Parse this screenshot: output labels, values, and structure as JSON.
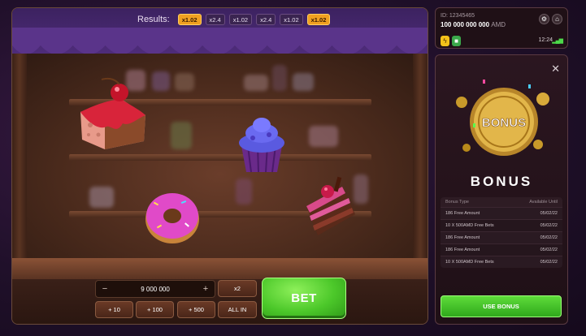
{
  "results": {
    "label": "Results:",
    "multipliers": [
      {
        "value": "x1.02",
        "highlighted": true
      },
      {
        "value": "x2.4",
        "highlighted": false
      },
      {
        "value": "x1.02",
        "highlighted": false
      },
      {
        "value": "x2.4",
        "highlighted": false
      },
      {
        "value": "x1.02",
        "highlighted": false
      },
      {
        "value": "x1.02",
        "highlighted": true
      }
    ]
  },
  "bet_controls": {
    "minus": "−",
    "plus": "+",
    "amount": "9 000 000",
    "double_label": "x2",
    "quick_adds": [
      "+ 10",
      "+ 100",
      "+ 500"
    ],
    "all_in_label": "ALL IN",
    "bet_label": "BET"
  },
  "account": {
    "id": "ID: 12345465",
    "balance": "100 000 000 000",
    "currency": "AMD",
    "time": "12:24",
    "settings_icon": "gear-icon",
    "home_icon": "home-icon"
  },
  "bonus": {
    "coin_text": "BONUS",
    "title": "BONUS",
    "columns": [
      "Bonus Type",
      "Available Until"
    ],
    "rows": [
      {
        "type": "186 Free Amount",
        "until": "05/02/22"
      },
      {
        "type": "10 X 500AMD Free Bets",
        "until": "05/02/22"
      },
      {
        "type": "186 Free Amount",
        "until": "05/02/22"
      },
      {
        "type": "186 Free Amount",
        "until": "05/02/22"
      },
      {
        "type": "10 X 500AMD Free Bets",
        "until": "05/02/22"
      }
    ],
    "use_label": "USE BONUS",
    "close_icon": "close-icon"
  },
  "colors": {
    "accent_green": "#4cc82a",
    "highlight_chip": "#f0a020",
    "curtain_purple": "#4e2c7a"
  }
}
